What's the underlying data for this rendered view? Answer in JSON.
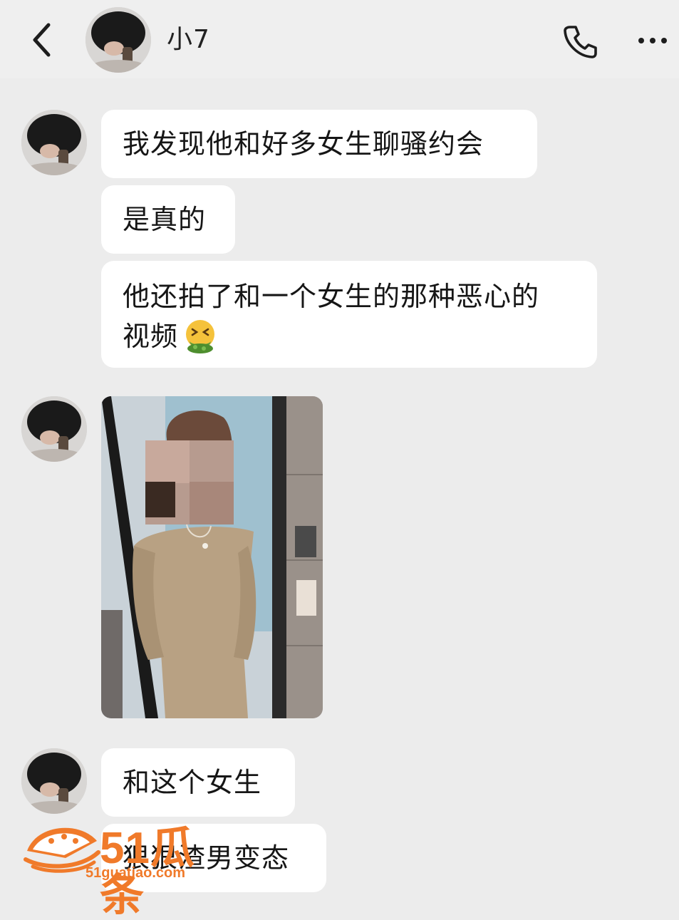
{
  "header": {
    "contact_name": "小7",
    "back_icon": "chevron-left-icon",
    "call_icon": "phone-icon",
    "more_icon": "more-horizontal-icon"
  },
  "messages": [
    {
      "text": "我发现他和好多女生聊骚约会"
    },
    {
      "text": "是真的"
    },
    {
      "line1": "他还拍了和一个女生的那种恶心的",
      "line2": "视频",
      "emoji": "nauseated-face-emoji"
    },
    {
      "type": "image",
      "description_icon": "photo-icon"
    },
    {
      "text": "和这个女生"
    },
    {
      "text": "狠狠渣男变态"
    }
  ],
  "watermark": {
    "brand": "51瓜条",
    "url": "51guatiao.com",
    "color": "#f07a2a"
  },
  "colors": {
    "background": "#ececec",
    "bubble": "#ffffff",
    "text": "#161616"
  }
}
